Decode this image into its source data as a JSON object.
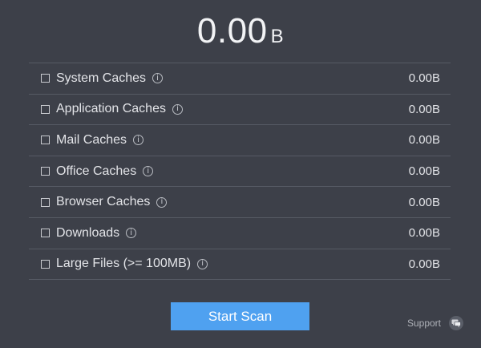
{
  "total": {
    "value": "0.00",
    "unit": "B"
  },
  "categories": [
    {
      "label": "System Caches",
      "size": "0.00B"
    },
    {
      "label": "Application Caches",
      "size": "0.00B"
    },
    {
      "label": "Mail Caches",
      "size": "0.00B"
    },
    {
      "label": "Office Caches",
      "size": "0.00B"
    },
    {
      "label": "Browser Caches",
      "size": "0.00B"
    },
    {
      "label": "Downloads",
      "size": "0.00B"
    },
    {
      "label": "Large Files (>= 100MB)",
      "size": "0.00B"
    }
  ],
  "info_glyph": "i",
  "actions": {
    "start_scan_label": "Start Scan"
  },
  "support": {
    "label": "Support",
    "icon": "chat-icon"
  },
  "colors": {
    "background": "#3d4049",
    "accent": "#4fa1f0"
  }
}
